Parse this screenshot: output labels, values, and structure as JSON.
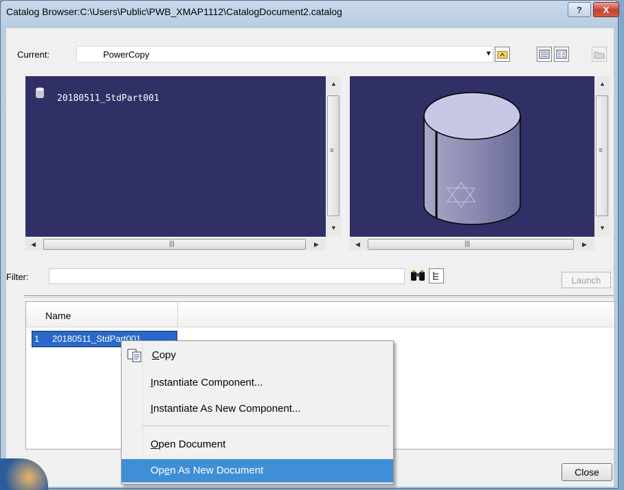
{
  "window": {
    "title": "Catalog Browser:C:\\Users\\Public\\PWB_XMAP1112\\CatalogDocument2.catalog",
    "help_glyph": "?",
    "close_glyph": "X"
  },
  "current": {
    "label": "Current:",
    "value": "PowerCopy"
  },
  "left_pane": {
    "item_label": "20180511_StdPart001"
  },
  "scroll": {
    "grip_v": "≡",
    "grip_h": "|||",
    "up": "▲",
    "down": "▼",
    "left": "◀",
    "right": "▶"
  },
  "filter": {
    "label": "Filter:",
    "value": "",
    "launch_label": "Launch"
  },
  "list": {
    "column_name": "Name",
    "rows": [
      {
        "index": "1",
        "name": "20180511_StdPart001"
      }
    ]
  },
  "context_menu": {
    "items": [
      {
        "pre": "",
        "key": "C",
        "post": "opy"
      },
      {
        "pre": "",
        "key": "I",
        "post": "nstantiate Component..."
      },
      {
        "pre": "",
        "key": "I",
        "post": "nstantiate As New Component..."
      },
      {
        "pre": "",
        "key": "O",
        "post": "pen Document"
      },
      {
        "pre": "Op",
        "key": "e",
        "post": "n As New Document"
      }
    ]
  },
  "buttons": {
    "close_label": "Close"
  },
  "colors": {
    "pane_bg": "#302f66",
    "selection": "#2a68c9",
    "menu_highlight": "#3f8fd7"
  }
}
